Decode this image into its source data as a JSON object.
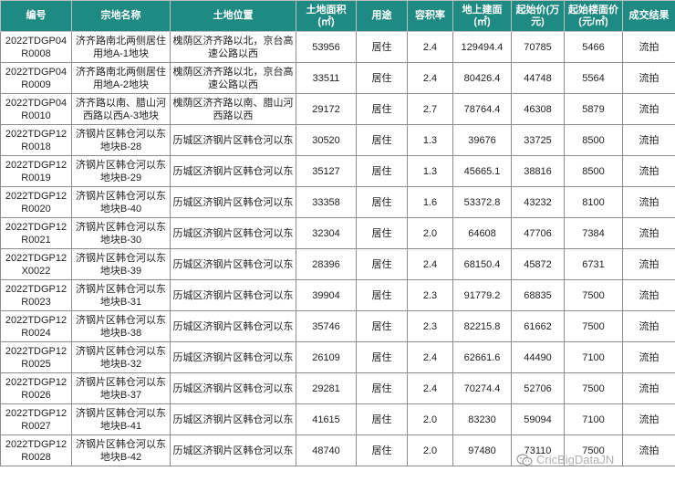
{
  "headers": [
    "编号",
    "宗地名称",
    "土地位置",
    "土地面积(㎡)",
    "用途",
    "容积率",
    "地上建面(㎡)",
    "起始价(万元)",
    "起始楼面价(元/㎡)",
    "成交结果"
  ],
  "rows": [
    [
      "2022TDGP04R0008",
      "济齐路南北两侧居住用地A-1地块",
      "槐荫区济齐路以北，京台高速公路以西",
      "53956",
      "居住",
      "2.4",
      "129494.4",
      "70785",
      "5466",
      "流拍"
    ],
    [
      "2022TDGP04R0009",
      "济齐路南北两侧居住用地A-2地块",
      "槐荫区济齐路以北，京台高速公路以西",
      "33511",
      "居住",
      "2.4",
      "80426.4",
      "44748",
      "5564",
      "流拍"
    ],
    [
      "2022TDGP04R0010",
      "济齐路以南、腊山河西路以西A-3地块",
      "槐荫区济齐路以南、腊山河西路以西",
      "29172",
      "居住",
      "2.7",
      "78764.4",
      "46308",
      "5879",
      "流拍"
    ],
    [
      "2022TDGP12R0018",
      "济钢片区韩仓河以东地块B-28",
      "历城区济钢片区韩仓河以东",
      "30520",
      "居住",
      "1.3",
      "39676",
      "33725",
      "8500",
      "流拍"
    ],
    [
      "2022TDGP12R0019",
      "济钢片区韩仓河以东地块B-29",
      "历城区济钢片区韩仓河以东",
      "35127",
      "居住",
      "1.3",
      "45665.1",
      "38816",
      "8500",
      "流拍"
    ],
    [
      "2022TDGP12R0020",
      "济钢片区韩仓河以东地块B-40",
      "历城区济钢片区韩仓河以东",
      "33358",
      "居住",
      "1.6",
      "53372.8",
      "43232",
      "8100",
      "流拍"
    ],
    [
      "2022TDGP12R0021",
      "济钢片区韩仓河以东地块B-30",
      "历城区济钢片区韩仓河以东",
      "32304",
      "居住",
      "2.0",
      "64608",
      "47706",
      "7384",
      "流拍"
    ],
    [
      "2022TDGP12X0022",
      "济钢片区韩仓河以东地块B-39",
      "历城区济钢片区韩仓河以东",
      "28396",
      "居住",
      "2.4",
      "68150.4",
      "45872",
      "6731",
      "流拍"
    ],
    [
      "2022TDGP12R0023",
      "济钢片区韩仓河以东地块B-31",
      "历城区济钢片区韩仓河以东",
      "39904",
      "居住",
      "2.3",
      "91779.2",
      "68835",
      "7500",
      "流拍"
    ],
    [
      "2022TDGP12R0024",
      "济钢片区韩仓河以东地块B-38",
      "历城区济钢片区韩仓河以东",
      "35746",
      "居住",
      "2.3",
      "82215.8",
      "61662",
      "7500",
      "流拍"
    ],
    [
      "2022TDGP12R0025",
      "济钢片区韩仓河以东地块B-32",
      "历城区济钢片区韩仓河以东",
      "26109",
      "居住",
      "2.4",
      "62661.6",
      "44490",
      "7100",
      "流拍"
    ],
    [
      "2022TDGP12R0026",
      "济钢片区韩仓河以东地块B-37",
      "历城区济钢片区韩仓河以东",
      "29281",
      "居住",
      "2.4",
      "70274.4",
      "52706",
      "7500",
      "流拍"
    ],
    [
      "2022TDGP12R0027",
      "济钢片区韩仓河以东地块B-41",
      "历城区济钢片区韩仓河以东",
      "41615",
      "居住",
      "2.0",
      "83230",
      "59094",
      "7100",
      "流拍"
    ],
    [
      "2022TDGP12R0028",
      "济钢片区韩仓河以东地块B-42",
      "历城区济钢片区韩仓河以东",
      "48740",
      "居住",
      "2.0",
      "97480",
      "73110",
      "7500",
      "流拍"
    ]
  ],
  "watermark": {
    "text": "CricBigDataJN",
    "icon": "wechat-icon"
  },
  "colors": {
    "header_bg": "#1f8a82",
    "header_text": "#ffffff"
  }
}
